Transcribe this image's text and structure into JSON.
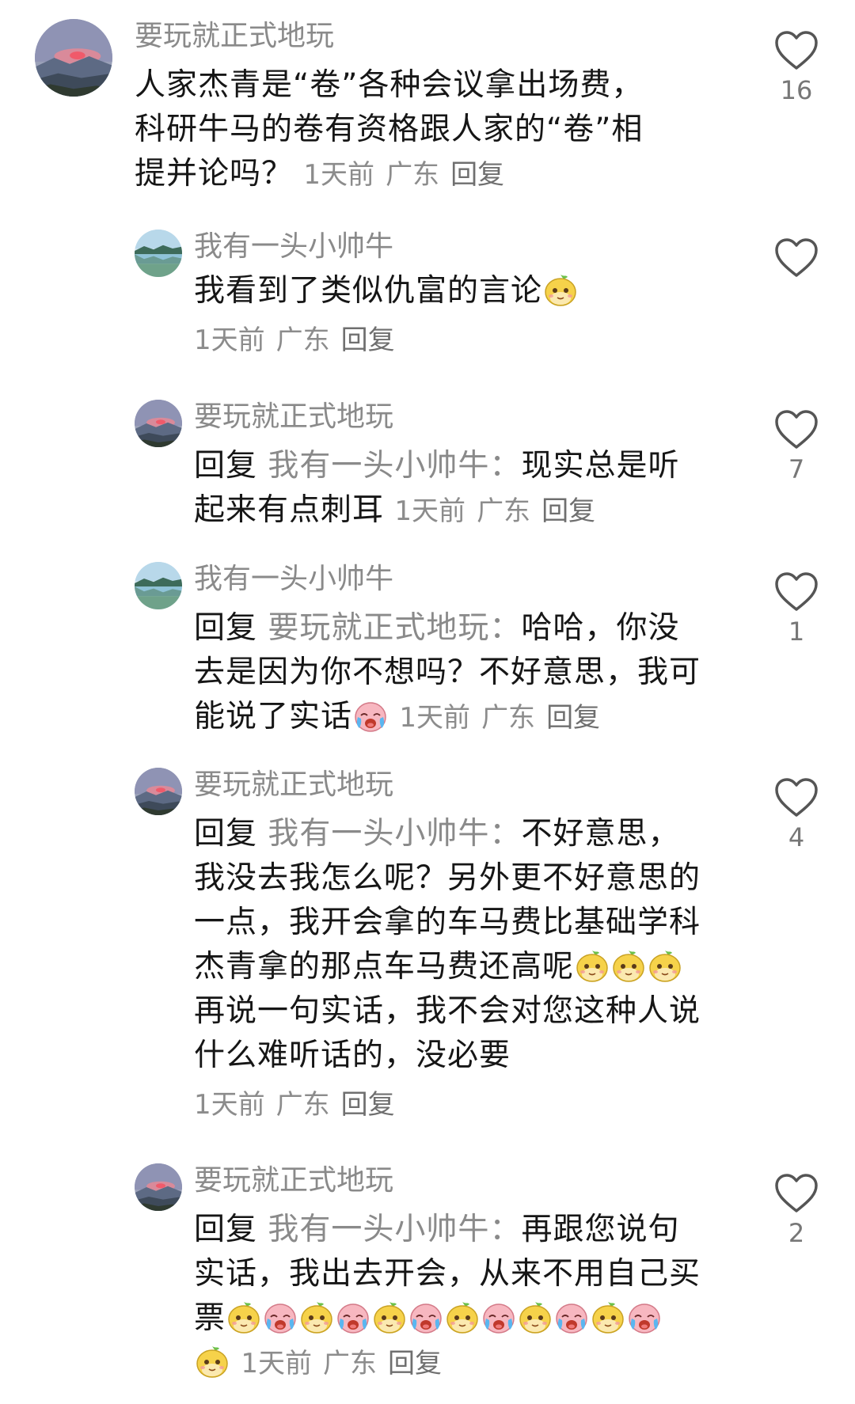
{
  "comments": [
    {
      "level": "top",
      "avatar": "sunset-mountain",
      "name": "要玩就正式地玩",
      "lines": [
        "人家杰青是“卷”各种会议拿出场费，",
        "科研牛马的卷有资格跟人家的“卷”相",
        "提并论吗？"
      ],
      "time": "1天前",
      "region": "广东",
      "reply_label": "回复",
      "likes": "16"
    },
    {
      "level": "reply",
      "avatar": "lake-landscape",
      "name": "我有一头小帅牛",
      "text": "我看到了类似仇富的言论",
      "emoji_tail": [
        "smug-face"
      ],
      "time": "1天前",
      "region": "广东",
      "reply_label": "回复",
      "likes": ""
    },
    {
      "level": "reply",
      "avatar": "sunset-mountain",
      "name": "要玩就正式地玩",
      "reply_prefix": "回复",
      "reply_target": "我有一头小帅牛：",
      "line1_rest": "现实总是听",
      "line2": "起来有点刺耳",
      "time": "1天前",
      "region": "广东",
      "reply_label": "回复",
      "likes": "7"
    },
    {
      "level": "reply",
      "avatar": "lake-landscape",
      "name": "我有一头小帅牛",
      "reply_prefix": "回复",
      "reply_target": "要玩就正式地玩：",
      "line1_rest": "哈哈，你没",
      "line2": "去是因为你不想吗？不好意思，我可",
      "line3": "能说了实话",
      "emoji_tail": [
        "crying-face"
      ],
      "time": "1天前",
      "region": "广东",
      "reply_label": "回复",
      "likes": "1"
    },
    {
      "level": "reply",
      "avatar": "sunset-mountain",
      "name": "要玩就正式地玩",
      "reply_prefix": "回复",
      "reply_target": "我有一头小帅牛：",
      "line1_rest": "不好意思，",
      "line2": "我没去我怎么呢？另外更不好意思的",
      "line3": "一点，我开会拿的车马费比基础学科",
      "line4": "杰青拿的那点车马费还高呢",
      "line4_emojis": [
        "smug-face",
        "smug-face",
        "smug-face"
      ],
      "line5": "再说一句实话，我不会对您这种人说",
      "line6": "什么难听话的，没必要",
      "time": "1天前",
      "region": "广东",
      "reply_label": "回复",
      "likes": "4"
    },
    {
      "level": "reply",
      "avatar": "sunset-mountain",
      "name": "要玩就正式地玩",
      "reply_prefix": "回复",
      "reply_target": "我有一头小帅牛：",
      "line1_rest": "再跟您说句",
      "line2": "实话，我出去开会，从来不用自己买",
      "line3": "票",
      "line3_emojis": [
        "smug-face",
        "crying-face",
        "smug-face",
        "crying-face",
        "smug-face",
        "crying-face",
        "smug-face",
        "crying-face",
        "smug-face",
        "crying-face",
        "smug-face",
        "crying-face"
      ],
      "line4_emojis": [
        "smug-face"
      ],
      "time": "1天前",
      "region": "广东",
      "reply_label": "回复",
      "likes": "2"
    }
  ],
  "colors": {
    "text": "#161616",
    "secondary": "#8a8a8a",
    "heart": "#555555"
  }
}
